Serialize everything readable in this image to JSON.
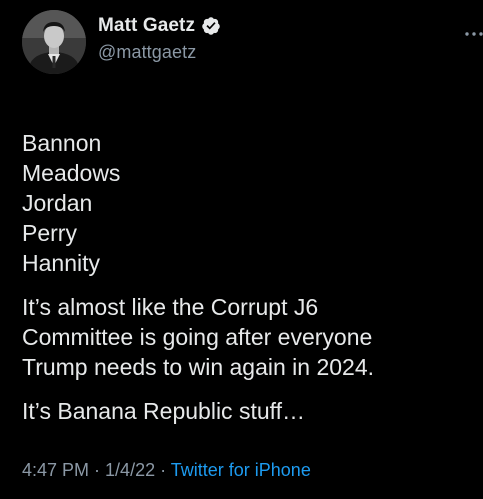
{
  "colors": {
    "background": "#000000",
    "text_primary": "#e7e9ea",
    "text_secondary": "#8b98a5",
    "link": "#1d9bf0",
    "verified_badge": "#e7e9ea"
  },
  "author": {
    "display_name": "Matt Gaetz",
    "handle": "@mattgaetz",
    "avatar_icon": "avatar",
    "verified_icon": "verified-badge-icon"
  },
  "actions": {
    "more_icon": "more-options-icon"
  },
  "tweet": {
    "names": [
      "Bannon",
      "Meadows",
      "Jordan",
      "Perry",
      "Hannity"
    ],
    "paragraph_1": [
      "It’s almost like the Corrupt J6",
      "Committee is going after everyone",
      "Trump needs to win again in 2024."
    ],
    "paragraph_2": [
      "It’s Banana Republic stuff…"
    ]
  },
  "meta": {
    "time": "4:47 PM",
    "separator": " · ",
    "date": "1/4/22",
    "source": "Twitter for iPhone"
  }
}
